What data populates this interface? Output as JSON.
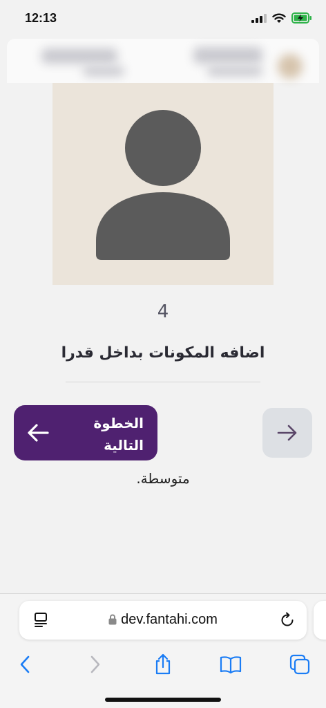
{
  "status_bar": {
    "time": "12:13"
  },
  "recipe_step": {
    "number": "4",
    "title": "اضافه المكونات بداخل قدرا",
    "difficulty": "متوسطة."
  },
  "navigation": {
    "next_label": "الخطوة\nالتالية"
  },
  "browser": {
    "url": "dev.fantahi.com"
  },
  "colors": {
    "primary": "#4f2170",
    "avatar_bg": "#ebe4da",
    "avatar_fg": "#5b5b5b",
    "secondary_button": "#dde0e4",
    "ios_blue": "#1a7cf5"
  }
}
